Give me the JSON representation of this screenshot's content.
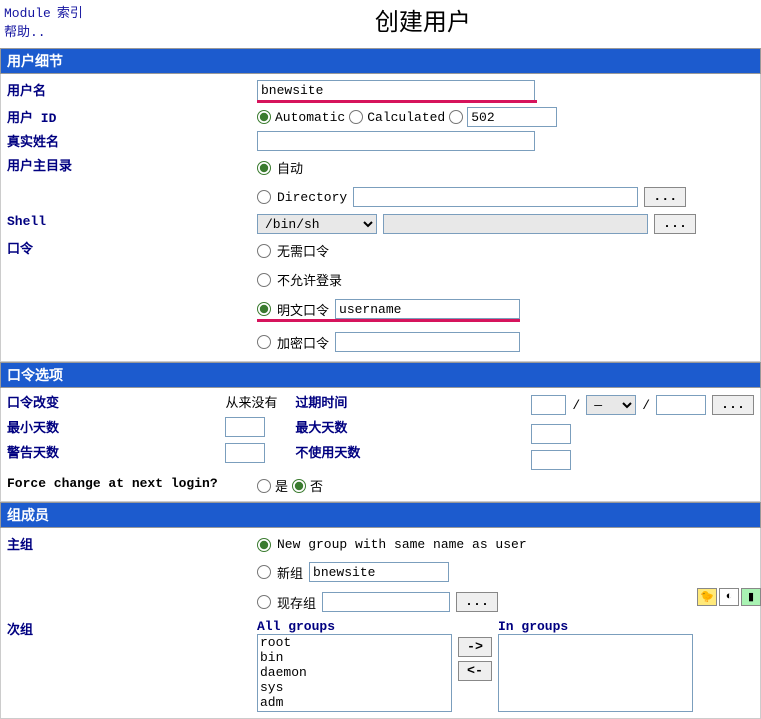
{
  "header": {
    "module_link": "Module",
    "index_link": "索引",
    "help_link": "帮助..",
    "title": "创建用户"
  },
  "sections": {
    "details": {
      "title": "用户细节"
    },
    "pwopts": {
      "title": "口令选项"
    },
    "groups": {
      "title": "组成员"
    }
  },
  "details": {
    "username_label": "用户名",
    "username_value": "bnewsite",
    "uid_label": "用户 ID",
    "uid_auto": "Automatic",
    "uid_calc": "Calculated",
    "uid_custom": "502",
    "realname_label": "真实姓名",
    "realname_value": "",
    "home_label": "用户主目录",
    "home_auto": "自动",
    "home_dir": "Directory",
    "home_dir_value": "",
    "shell_label": "Shell",
    "shell_value": "/bin/sh",
    "shell_custom": "",
    "password_label": "口令",
    "pw_none": "无需口令",
    "pw_nologin": "不允许登录",
    "pw_plain": "明文口令",
    "pw_plain_value": "username",
    "pw_crypt": "加密口令",
    "pw_crypt_value": ""
  },
  "pwopts": {
    "change_label": "口令改变",
    "change_value": "从来没有",
    "expire_label": "过期时间",
    "date_sep": "/",
    "date_dash": "—",
    "min_label": "最小天数",
    "min_value": "",
    "max_label": "最大天数",
    "max_value": "",
    "warn_label": "警告天数",
    "warn_value": "",
    "inactive_label": "不使用天数",
    "inactive_value": "",
    "force_label": "Force change at next login?",
    "yes": "是",
    "no": "否"
  },
  "groups": {
    "primary_label": "主组",
    "new_same": "New group with same name as user",
    "new_group": "新组",
    "new_group_value": "bnewsite",
    "existing": "现存组",
    "existing_value": "",
    "secondary_label": "次组",
    "all_label": "All groups",
    "in_label": "In groups",
    "all_items": [
      "root",
      "bin",
      "daemon",
      "sys",
      "adm"
    ],
    "arrow_right": "->",
    "arrow_left": "<-"
  },
  "icons": {
    "dots": "..."
  }
}
